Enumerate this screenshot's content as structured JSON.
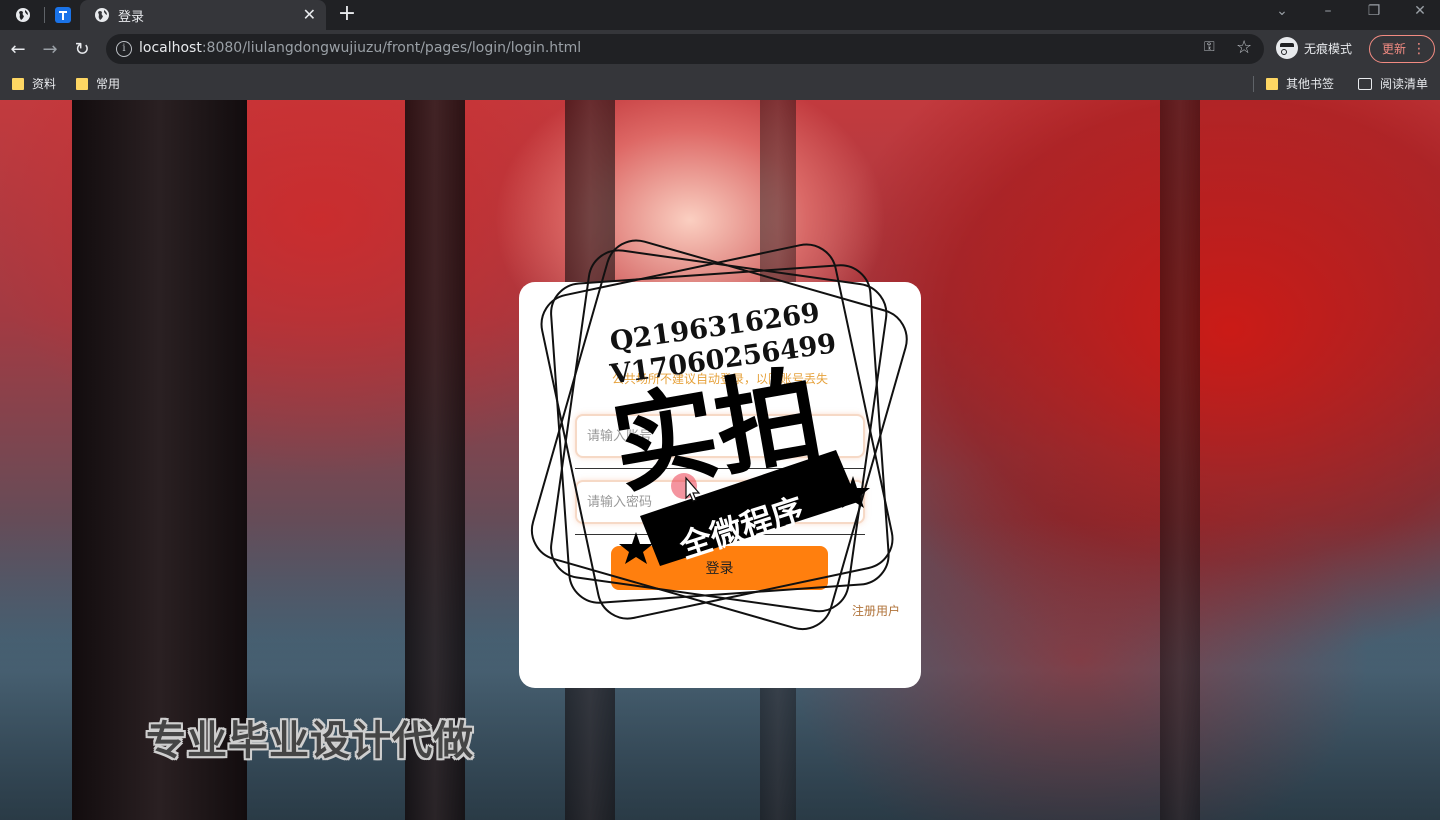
{
  "browser": {
    "tab": {
      "title": "登录"
    },
    "url": {
      "host": "localhost",
      "path": ":8080/liulangdongwujiuzu/front/pages/login/login.html"
    },
    "incognito_label": "无痕模式",
    "update_label": "更新",
    "bookmarks": [
      {
        "label": "资料",
        "icon": "folder-icon"
      },
      {
        "label": "常用",
        "icon": "folder-icon"
      }
    ],
    "other_bookmarks": "其他书签",
    "reading_list": "阅读清单"
  },
  "login": {
    "notice": "公共场所不建议自动登录，以防账号丢失",
    "account_placeholder": "请输入账号",
    "password_placeholder": "请输入密码",
    "submit_label": "登录",
    "register_label": "注册用户",
    "accent_color": "#ff7f0e"
  },
  "stamp": {
    "qq": "Q2196316269",
    "wechat": "V17060256499",
    "big_text": "实拍",
    "ribbon_text": "全微程序"
  },
  "watermark": "专业毕业设计代做"
}
